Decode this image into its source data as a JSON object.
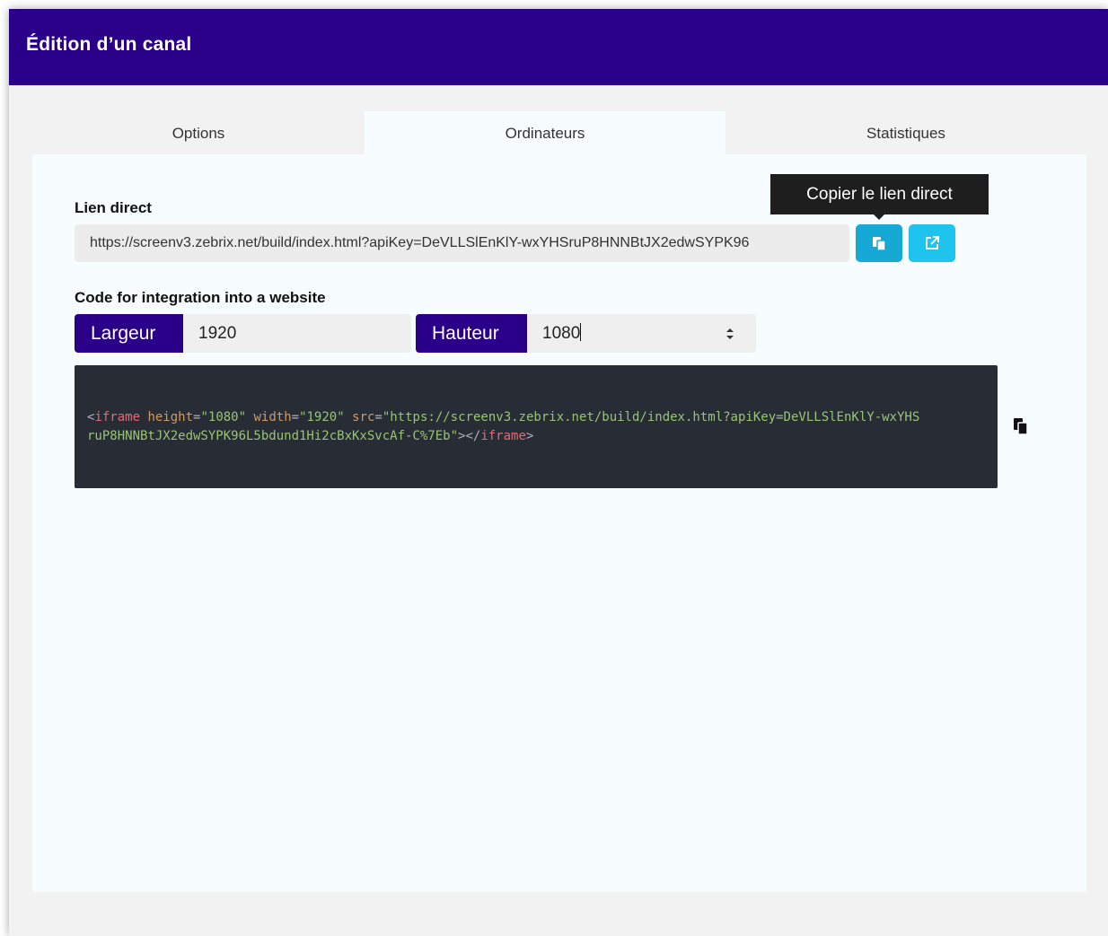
{
  "header": {
    "title": "Édition d’un canal",
    "background_color": "#2b0088"
  },
  "tabs": [
    {
      "label": "Options",
      "active": false
    },
    {
      "label": "Ordinateurs",
      "active": true
    },
    {
      "label": "Statistiques",
      "active": false
    }
  ],
  "direct_link": {
    "label": "Lien direct",
    "value": "https://screenv3.zebrix.net/build/index.html?apiKey=DeVLLSlEnKlY-wxYHSruP8HNNBtJX2edwSYPK96",
    "copy_button_icon": "copy-icon",
    "open_button_icon": "external-link-icon",
    "copy_tooltip": "Copier le lien direct",
    "copy_color": "#17a9d6",
    "open_color": "#1ec3ee"
  },
  "integration": {
    "label": "Code for integration into a website",
    "width_label": "Largeur",
    "width_value": "1920",
    "height_label": "Hauteur",
    "height_value": "1080",
    "code": {
      "open_tag": "<",
      "tag_name": "iframe",
      "attr_height": "height",
      "eq": "=",
      "height_val": "\"1080\"",
      "attr_width": "width",
      "width_val": "\"1920\"",
      "attr_src": "src",
      "src_val_1": "\"https://screenv3.zebrix.net/build/index.html?apiKey=DeVLLSlEnKlY-wxYHS",
      "src_val_2": "ruP8HNNBtJX2edwSYPK96L5bdund1Hi2cBxKxSvcAf-C%7Eb\"",
      "close_open": "></",
      "close_end": ">"
    },
    "copy_code_icon": "copy-icon"
  }
}
